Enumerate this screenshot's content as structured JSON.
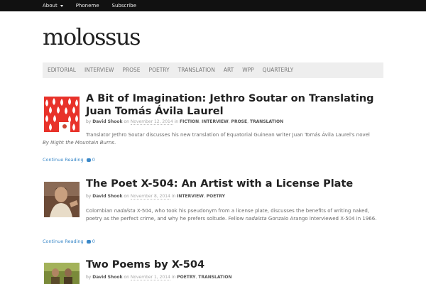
{
  "topbar": {
    "items": [
      {
        "label": "About"
      },
      {
        "label": "Phoneme"
      },
      {
        "label": "Subscribe"
      }
    ]
  },
  "site": {
    "logo": "molossus"
  },
  "nav": {
    "items": [
      "EDITORIAL",
      "INTERVIEW",
      "PROSE",
      "POETRY",
      "TRANSLATION",
      "ART",
      "WPP",
      "QUARTERLY"
    ]
  },
  "posts": [
    {
      "title": "A Bit of Imagination: Jethro Soutar on Translating Juan Tomás Ávila Laurel",
      "by": "by",
      "author": "David Shook",
      "on": "on",
      "date": "November 12, 2014",
      "in": "in",
      "categories": [
        "FICTION",
        "INTERVIEW",
        "PROSE",
        "TRANSLATION"
      ],
      "excerpt": "Translator Jethro Soutar discusses his new translation of Equatorial Guinean writer Juan Tomás Ávila Laurel's novel",
      "excerpt_em": "By Night the Mountain Burns",
      "excerpt_tail": ".",
      "continue": "Continue Reading",
      "comments": "0"
    },
    {
      "title": "The Poet X-504: An Artist with a License Plate",
      "by": "by",
      "author": "David Shook",
      "on": "on",
      "date": "November 8, 2014",
      "in": "in",
      "categories": [
        "INTERVIEW",
        "POETRY"
      ],
      "excerpt_a": "Colombian",
      "excerpt_em1": "nadaísta",
      "excerpt_b": "X-504, who took his pseudonym from a license plate, discusses the benefits of writing naked, poetry as the perfect crime, and why he prefers soltude. Fellow",
      "excerpt_em2": "nadaísta",
      "excerpt_c": "Gonzalo Arango interviewed X-504 in 1966.",
      "continue": "Continue Reading",
      "comments": "0"
    },
    {
      "title": "Two Poems by X-504",
      "by": "by",
      "author": "David Shook",
      "on": "on",
      "date": "November 1, 2014",
      "in": "in",
      "categories": [
        "POETRY",
        "TRANSLATION"
      ]
    }
  ],
  "colors": {
    "topbar": "#111111",
    "link": "#3a88c8",
    "nav_bg": "#eeeeee"
  }
}
